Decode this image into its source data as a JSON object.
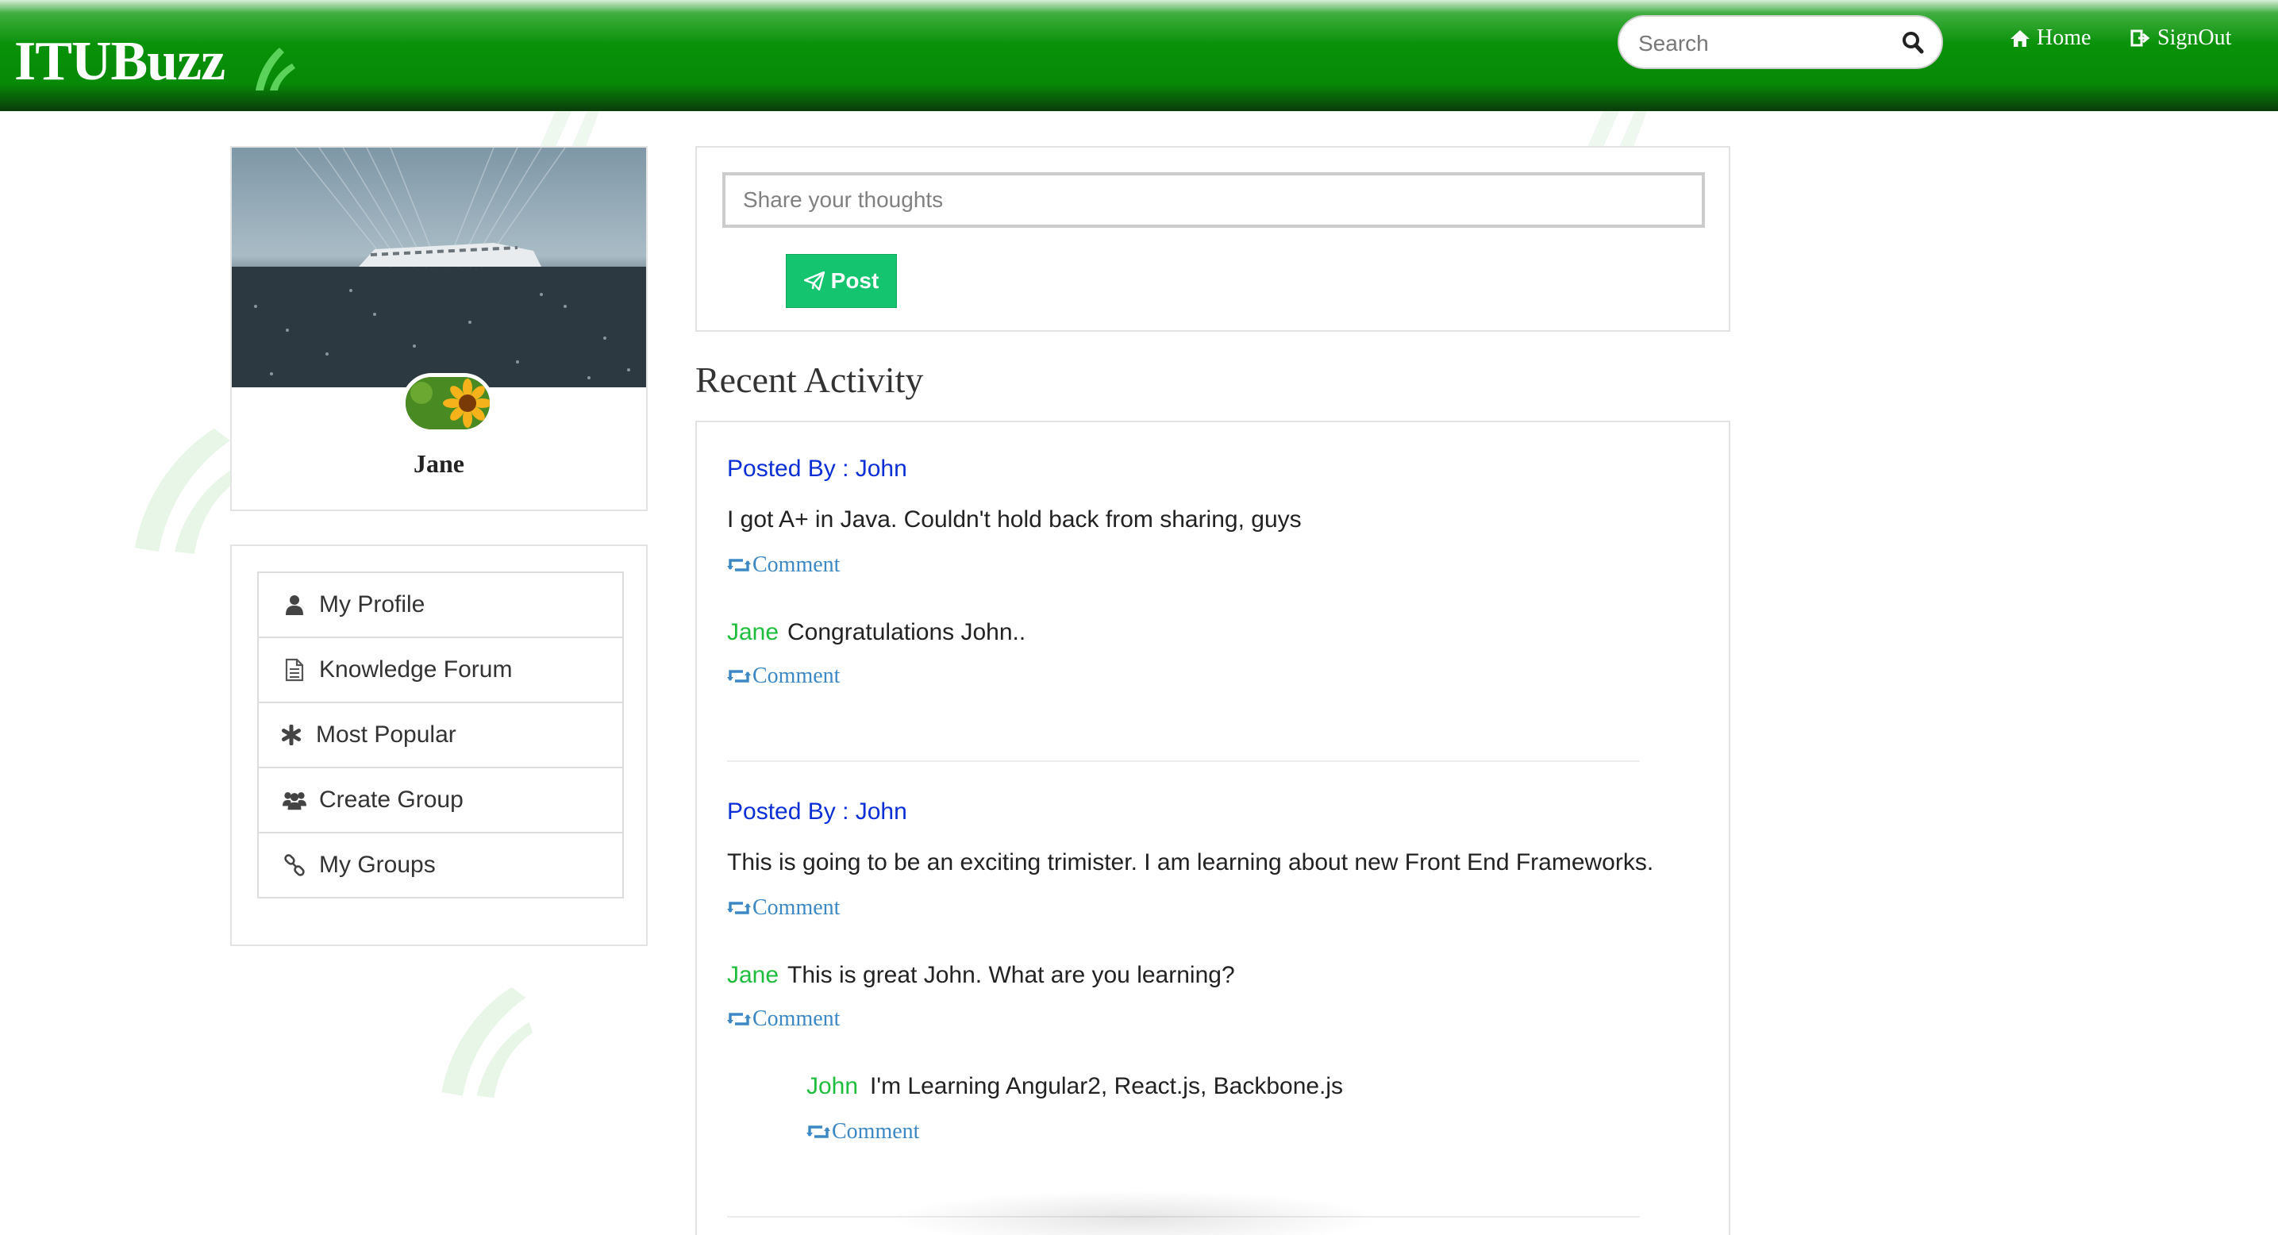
{
  "app": {
    "logo_text": "ITUBuzz"
  },
  "header": {
    "search_placeholder": "Search",
    "nav": {
      "home_label": "Home",
      "signout_label": "SignOut"
    }
  },
  "profile": {
    "name": "Jane"
  },
  "menu": {
    "items": [
      {
        "label": "My Profile",
        "icon": "user-icon"
      },
      {
        "label": "Knowledge Forum",
        "icon": "document-icon"
      },
      {
        "label": "Most Popular",
        "icon": "asterisk-icon"
      },
      {
        "label": "Create Group",
        "icon": "users-icon"
      },
      {
        "label": "My Groups",
        "icon": "link-icon"
      }
    ]
  },
  "compose": {
    "placeholder": "Share your thoughts",
    "post_label": "Post"
  },
  "feed": {
    "title": "Recent Activity",
    "comment_label": "Comment",
    "posts": [
      {
        "posted_by": "Posted By : John",
        "text": "I got A+ in Java. Couldn't hold back from sharing, guys",
        "replies": [
          {
            "author": "Jane",
            "text": "Congratulations John.."
          }
        ]
      },
      {
        "posted_by": "Posted By : John",
        "text": "This is going to be an exciting trimister. I am learning about new Front End Frameworks.",
        "replies": [
          {
            "author": "Jane",
            "text": "This is great John. What are you learning?"
          },
          {
            "author": "John",
            "text": "I'm Learning Angular2, React.js, Backbone.js"
          }
        ]
      }
    ]
  },
  "colors": {
    "header_green": "#099109",
    "post_button": "#14c46e",
    "posted_by_blue": "#0b2fd6",
    "reply_author_green": "#1ebe3c",
    "comment_link_blue": "#3b88c4"
  }
}
